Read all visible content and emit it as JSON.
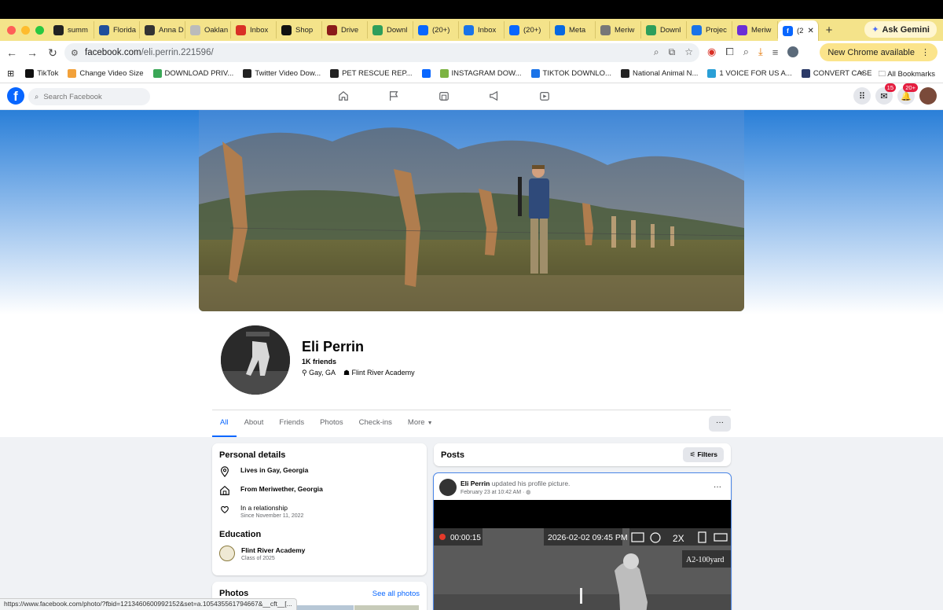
{
  "browser": {
    "tabs": [
      {
        "title": "summ",
        "color": "#222222"
      },
      {
        "title": "Florida",
        "color": "#1f4e9c"
      },
      {
        "title": "Anna D",
        "color": "#333333"
      },
      {
        "title": "Oaklan",
        "color": "#bbbbbb"
      },
      {
        "title": "Inbox",
        "color": "#d93025"
      },
      {
        "title": "Shop",
        "color": "#111111"
      },
      {
        "title": "Drive",
        "color": "#8b1a1a"
      },
      {
        "title": "Downl",
        "color": "#2e9e5b"
      },
      {
        "title": "(20+)",
        "color": "#0866ff"
      },
      {
        "title": "Inbox",
        "color": "#1a73e8"
      },
      {
        "title": "(20+)",
        "color": "#0866ff"
      },
      {
        "title": "Meta",
        "color": "#0668e1"
      },
      {
        "title": "Meriw",
        "color": "#777777"
      },
      {
        "title": "Downl",
        "color": "#2e9e5b"
      },
      {
        "title": "Projec",
        "color": "#1a73e8"
      },
      {
        "title": "Meriw",
        "color": "#6b2fd6"
      }
    ],
    "active_tab": "(2",
    "ask_gemini": "Ask Gemini",
    "url_host": "facebook.com",
    "url_path": "/eli.perrin.221596/",
    "new_chrome": "New Chrome available",
    "bookmarks": [
      {
        "label": "TikTok",
        "color": "#111111"
      },
      {
        "label": "Change Video Size",
        "color": "#f2a13a"
      },
      {
        "label": "DOWNLOAD PRIV...",
        "color": "#3aa757"
      },
      {
        "label": "Twitter Video Dow...",
        "color": "#222222"
      },
      {
        "label": "PET RESCUE REP...",
        "color": "#222222"
      },
      {
        "label": "",
        "color": "#0866ff"
      },
      {
        "label": "INSTAGRAM DOW...",
        "color": "#7cb342"
      },
      {
        "label": "TIKTOK DOWNLO...",
        "color": "#1a73e8"
      },
      {
        "label": "National Animal N...",
        "color": "#222222"
      },
      {
        "label": "1 VOICE FOR US A...",
        "color": "#2a9fd6"
      },
      {
        "label": "CONVERT CASE",
        "color": "#2b3a67"
      }
    ],
    "all_bookmarks": "All Bookmarks",
    "status_url": "https://www.facebook.com/photo/?fbid=1213460600992152&set=a.105435561794667&__cft__[..."
  },
  "fb": {
    "search_placeholder": "Search Facebook",
    "messenger_badge": "15",
    "notifications_badge": "20+"
  },
  "profile": {
    "name": "Eli Perrin",
    "friends": "1K friends",
    "location": "Gay, GA",
    "school": "Flint River Academy",
    "tabs": [
      "All",
      "About",
      "Friends",
      "Photos",
      "Check-ins",
      "More"
    ]
  },
  "personal_details": {
    "title": "Personal details",
    "lives_in": "Lives in Gay, Georgia",
    "from": "From Meriwether, Georgia",
    "relationship": "In a relationship",
    "relationship_since": "Since November 11, 2022",
    "education_title": "Education",
    "edu_school": "Flint River Academy",
    "edu_class": "Class of 2025"
  },
  "photos": {
    "title": "Photos",
    "see_all": "See all photos"
  },
  "posts": {
    "title": "Posts",
    "filters": "Filters",
    "author": "Eli Perrin",
    "action": "updated his profile picture.",
    "date": "February 23 at 10:42 AM",
    "overlay_timer": "00:00:15",
    "overlay_datetime": "2026-02-02 09:45 PM",
    "overlay_zoom": "2X",
    "overlay_range": "A2-100yard"
  }
}
